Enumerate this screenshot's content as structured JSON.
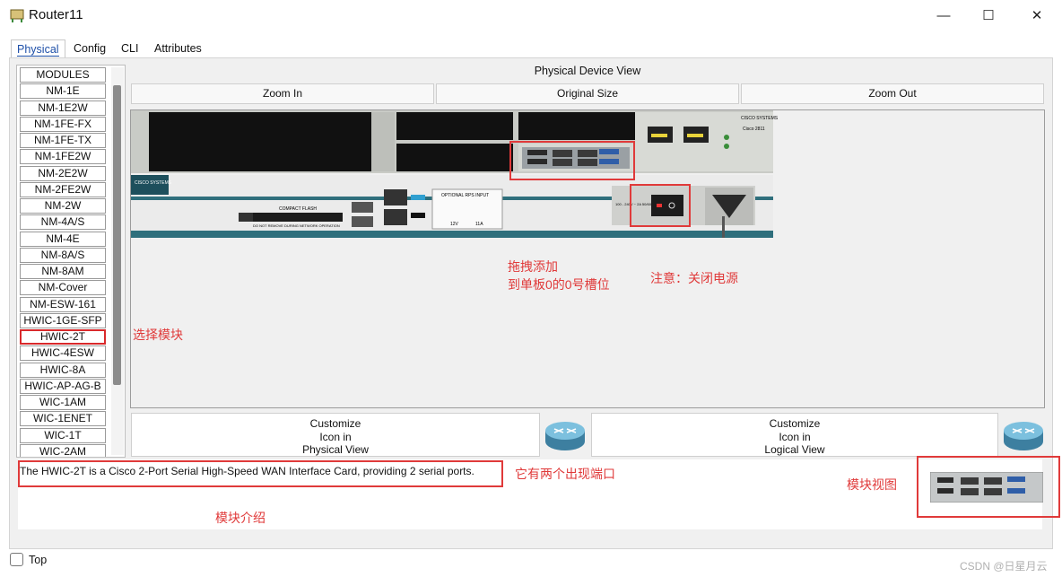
{
  "window": {
    "title": "Router11",
    "minimize": "—",
    "maximize": "☐",
    "close": "✕"
  },
  "tabs": [
    "Physical",
    "Config",
    "CLI",
    "Attributes"
  ],
  "modules": {
    "header": "MODULES",
    "items": [
      "NM-1E",
      "NM-1E2W",
      "NM-1FE-FX",
      "NM-1FE-TX",
      "NM-1FE2W",
      "NM-2E2W",
      "NM-2FE2W",
      "NM-2W",
      "NM-4A/S",
      "NM-4E",
      "NM-8A/S",
      "NM-8AM",
      "NM-Cover",
      "NM-ESW-161",
      "HWIC-1GE-SFP",
      "HWIC-2T",
      "HWIC-4ESW",
      "HWIC-8A",
      "HWIC-AP-AG-B",
      "WIC-1AM",
      "WIC-1ENET",
      "WIC-1T",
      "WIC-2AM"
    ],
    "selected": "HWIC-2T"
  },
  "device_view": {
    "title": "Physical Device View",
    "zoom_in": "Zoom In",
    "original_size": "Original Size",
    "zoom_out": "Zoom Out"
  },
  "customize": {
    "physical": [
      "Customize",
      "Icon in",
      "Physical View"
    ],
    "logical": [
      "Customize",
      "Icon in",
      "Logical View"
    ]
  },
  "description": "The HWIC-2T is a Cisco 2-Port Serial High-Speed WAN Interface Card, providing 2 serial ports.",
  "annotations": {
    "drag_line1": "拖拽添加",
    "drag_line2": "到单板0的0号槽位",
    "power_note": "注意：关闭电源",
    "select_module": "选择模块",
    "two_ports": "它有两个出现端口",
    "module_view": "模块视图",
    "module_intro": "模块介绍"
  },
  "device_labels": {
    "cisco": "CISCO SYSTEMS",
    "compact_flash": "COMPACT FLASH",
    "rps": "OPTIONAL RPS INPUT",
    "rps_v": "12V",
    "rps_a": "11A",
    "leds": [
      "SYS PWR",
      "AUX/ PWR",
      "SYS ACT",
      "CF"
    ],
    "power_spec": "100 - 240V ~ 2A 50/60 Hz",
    "cf_warning": "DO NOT REMOVE DURING NETWORK OPERATION",
    "model": "Cisco 2811",
    "fe01": "FE 0/1",
    "fe00": "FE 0/0"
  },
  "bottom": {
    "top_label": "Top",
    "watermark": "CSDN @日星月云"
  },
  "colors": {
    "accent": "#1d4fa8",
    "annotation": "#e03a3a",
    "chassis_teal": "#2f6f7c"
  }
}
